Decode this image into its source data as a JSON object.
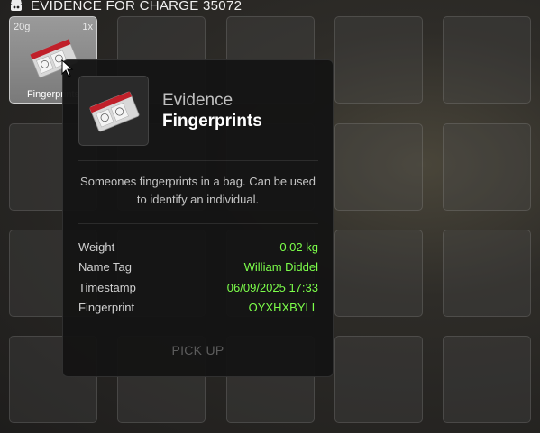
{
  "header": {
    "title": "EVIDENCE FOR CHARGE 35072",
    "icon": "evidence-icon"
  },
  "inventory": {
    "slots": [
      {
        "weight": "20g",
        "count": "1x",
        "label": "Fingerprints",
        "icon": "fingerprint-bag-icon"
      }
    ]
  },
  "tooltip": {
    "category": "Evidence",
    "name": "Fingerprints",
    "description": "Someones fingerprints in a bag. Can be used to identify an individual.",
    "stats": [
      {
        "key": "Weight",
        "value": "0.02 kg"
      },
      {
        "key": "Name Tag",
        "value": "William Diddel"
      },
      {
        "key": "Timestamp",
        "value": "06/09/2025 17:33"
      },
      {
        "key": "Fingerprint",
        "value": "OYXHXBYLL"
      }
    ],
    "action_label": "PICK UP"
  },
  "colors": {
    "value_text": "#7cff4a",
    "panel_bg": "#141414"
  }
}
